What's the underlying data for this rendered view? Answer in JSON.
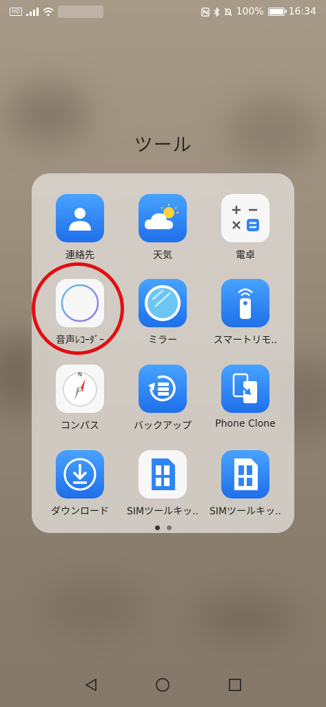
{
  "status_bar": {
    "hd_label": "HD",
    "battery_percent": "100%",
    "battery_level": 1.0,
    "time": "16:34"
  },
  "folder": {
    "title": "ツール",
    "page_count": 2,
    "current_page": 1,
    "apps": [
      {
        "label": "連絡先",
        "icon": "contacts-icon"
      },
      {
        "label": "天気",
        "icon": "weather-icon"
      },
      {
        "label": "電卓",
        "icon": "calculator-icon"
      },
      {
        "label": "音声ﾚｺｰﾀﾞｰ",
        "icon": "voice-recorder-icon"
      },
      {
        "label": "ミラー",
        "icon": "mirror-icon"
      },
      {
        "label": "スマートリモ..",
        "icon": "smart-remote-icon"
      },
      {
        "label": "コンパス",
        "icon": "compass-icon"
      },
      {
        "label": "バックアップ",
        "icon": "backup-icon"
      },
      {
        "label": "Phone Clone",
        "icon": "phone-clone-icon"
      },
      {
        "label": "ダウンロード",
        "icon": "download-icon"
      },
      {
        "label": "SIMツールキッ..",
        "icon": "sim-toolkit-icon"
      },
      {
        "label": "SIMツールキッ..",
        "icon": "sim-toolkit-icon"
      }
    ]
  },
  "annotation": {
    "color": "#e00f12"
  },
  "navigation": {
    "back": "back-icon",
    "home": "home-icon",
    "recents": "recents-icon"
  }
}
